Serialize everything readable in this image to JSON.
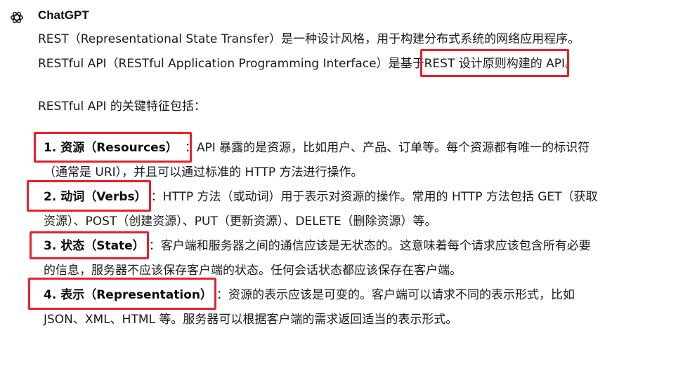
{
  "message": {
    "sender": "ChatGPT",
    "avatar_icon": "openai-logo-icon",
    "highlight_color": "#e8202a",
    "para1_line1": "REST（Representational State Transfer）是一种设计风格，用于构建分布式系统的网络应用程序。",
    "para1_line2_prefix": "RESTful API（RESTful Application Programming Interface）是基于",
    "para1_line2_highlight": "REST 设计原则构建的 API",
    "para1_line2_suffix": "。",
    "intro": "RESTful API 的关键特征包括：",
    "items": [
      {
        "title": "1. 资源（Resources）",
        "line1": "：API 暴露的是资源，比如用户、产品、订单等。每个资源都有唯一的标识符",
        "line2": "（通常是 URI），并且可以通过标准的 HTTP 方法进行操作。"
      },
      {
        "title": "2. 动词（Verbs）",
        "line1": "：HTTP 方法（或动词）用于表示对资源的操作。常用的 HTTP 方法包括 GET（获取",
        "line2": "资源）、POST（创建资源）、PUT（更新资源）、DELETE（删除资源）等。"
      },
      {
        "title": "3. 状态（State）",
        "line1": "：客户端和服务器之间的通信应该是无状态的。这意味着每个请求应该包含所有必要",
        "line2": "的信息，服务器不应该保存客户端的状态。任何会话状态都应该保存在客户端。"
      },
      {
        "title": "4. 表示（Representation）",
        "line1": "：资源的表示应该是可变的。客户端可以请求不同的表示形式，比如",
        "line2": "JSON、XML、HTML 等。服务器可以根据客户端的需求返回适当的表示形式。"
      }
    ]
  }
}
